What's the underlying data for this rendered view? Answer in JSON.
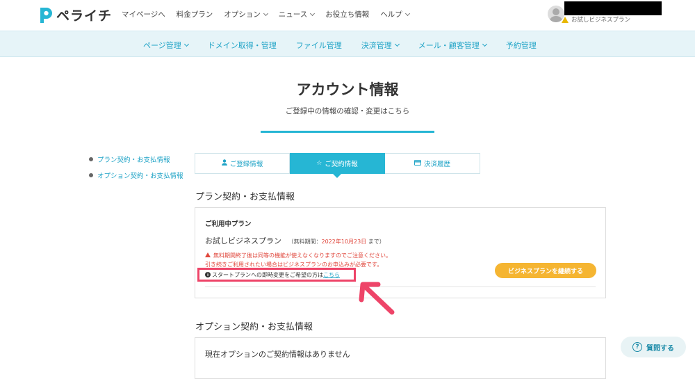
{
  "header": {
    "logo_text": "ペライチ",
    "nav": [
      {
        "label": "マイページへ",
        "dropdown": false
      },
      {
        "label": "料金プラン",
        "dropdown": false
      },
      {
        "label": "オプション",
        "dropdown": true
      },
      {
        "label": "ニュース",
        "dropdown": true
      },
      {
        "label": "お役立ち情報",
        "dropdown": false
      },
      {
        "label": "ヘルプ",
        "dropdown": true
      }
    ],
    "user_plan": "お試しビジネスプラン"
  },
  "main_nav": [
    {
      "label": "ページ管理",
      "dropdown": true
    },
    {
      "label": "ドメイン取得・管理",
      "dropdown": false
    },
    {
      "label": "ファイル管理",
      "dropdown": false
    },
    {
      "label": "決済管理",
      "dropdown": true
    },
    {
      "label": "メール・顧客管理",
      "dropdown": true
    },
    {
      "label": "予約管理",
      "dropdown": false
    }
  ],
  "page": {
    "title": "アカウント情報",
    "subtitle": "ご登録中の情報の確認・変更はこちら"
  },
  "side_links": [
    "プラン契約・お支払情報",
    "オプション契約・お支払情報"
  ],
  "tabs": [
    {
      "label": "ご登録情報",
      "icon": "user-icon",
      "active": false
    },
    {
      "label": "ご契約情報",
      "icon": "star-icon",
      "active": true
    },
    {
      "label": "決済履歴",
      "icon": "card-icon",
      "active": false
    }
  ],
  "plan_section": {
    "title": "プラン契約・お支払情報",
    "label": "ご利用中プラン",
    "plan_name": "お試しビジネスプラン",
    "trial_prefix": "（無料期間：",
    "trial_date": "2022年10月23日",
    "trial_suffix": " まで）",
    "notice_line1": "無料期間終了後は同等の機能が使えなくなりますのでご注意ください。",
    "notice_line2": "引き続きご利用されたい場合はビジネスプランのお申込みが必要です。",
    "switch_text": "スタートプランへの即時変更をご希望の方は",
    "switch_link": "こちら",
    "continue_button": "ビジネスプランを継続する"
  },
  "option_section": {
    "title": "オプション契約・お支払情報",
    "empty_text": "現在オプションのご契約情報はありません"
  },
  "help_button": "質問する",
  "colors": {
    "accent": "#26b6d4",
    "highlight_box": "#ee4468",
    "continue_button": "#f5b532",
    "warning": "#e0473c"
  }
}
